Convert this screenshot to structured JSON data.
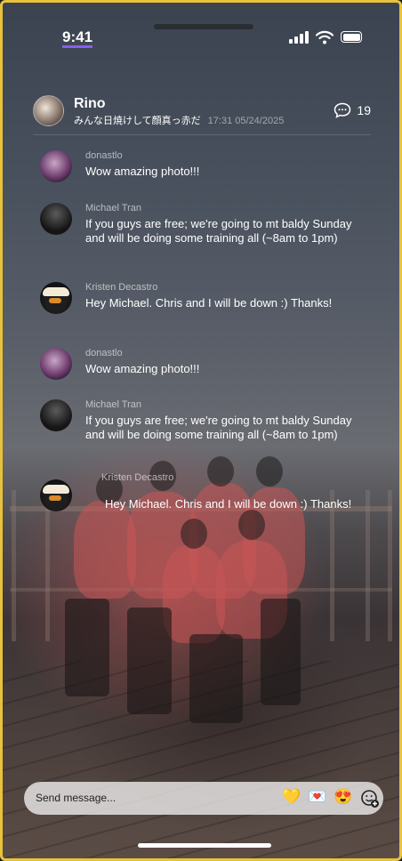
{
  "status_bar": {
    "time": "9:41"
  },
  "header": {
    "name": "Rino",
    "caption": "みんな日焼けして顔真っ赤だ",
    "timestamp": "17:31 05/24/2025",
    "comment_count": "19",
    "comment_icon": "chat-bubble-icon"
  },
  "messages": [
    {
      "author": "donastlo",
      "text": "Wow amazing photo!!!"
    },
    {
      "author": "Michael Tran",
      "text": "If you guys are free; we're going to mt baldy Sunday and will be doing some training all (~8am to 1pm)"
    },
    {
      "author": "Kristen Decastro",
      "text": "Hey Michael. Chris and I will be down :) Thanks!"
    },
    {
      "author": "donastlo",
      "text": " Wow amazing photo!!!"
    },
    {
      "author": "Michael Tran",
      "text": "If you guys are free; we're going to mt baldy Sunday and will be doing some training all (~8am to 1pm)"
    },
    {
      "author": "Kristen Decastro",
      "text": "Hey Michael. Chris and I will be down :) Thanks!"
    }
  ],
  "composer": {
    "placeholder": "Send message...",
    "reactions": [
      "💛",
      "💌",
      "😍"
    ],
    "add_reaction_icon": "add-emoji-icon"
  },
  "colors": {
    "frame_border": "#e8c23a",
    "time_underline": "#8a5cf6"
  }
}
